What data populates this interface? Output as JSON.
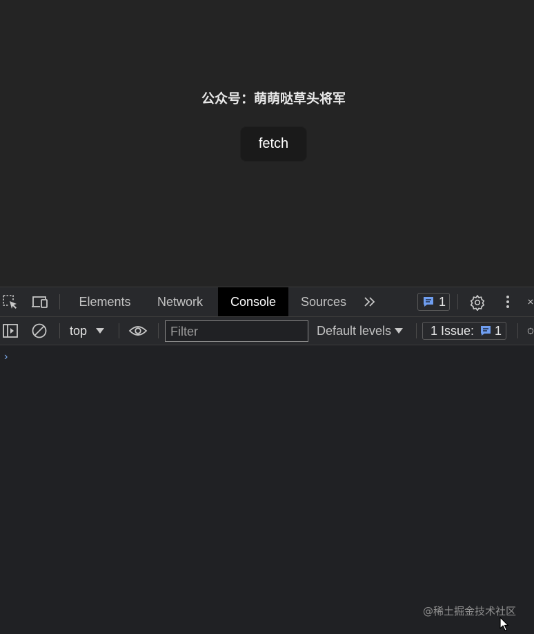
{
  "page": {
    "headline": "公众号：萌萌哒草头将军",
    "fetch_button": "fetch"
  },
  "devtools": {
    "tabs": [
      {
        "label": "Elements",
        "active": false
      },
      {
        "label": "Network",
        "active": false
      },
      {
        "label": "Console",
        "active": true
      },
      {
        "label": "Sources",
        "active": false
      }
    ],
    "more_tabs_icon": "double-chevron-right-icon",
    "messages_count": "1",
    "toolbar": {
      "context": "top",
      "filter_placeholder": "Filter",
      "levels": "Default levels",
      "issues_label": "1 Issue:",
      "issues_count": "1"
    },
    "console_prompt": "›"
  },
  "watermark": "@稀土掘金技术社区",
  "colors": {
    "page_bg": "#242424",
    "devtools_bg": "#202124",
    "toolbar_bg": "#28292c",
    "active_tab_bg": "#000000",
    "accent_blue": "#7aa7e8"
  }
}
